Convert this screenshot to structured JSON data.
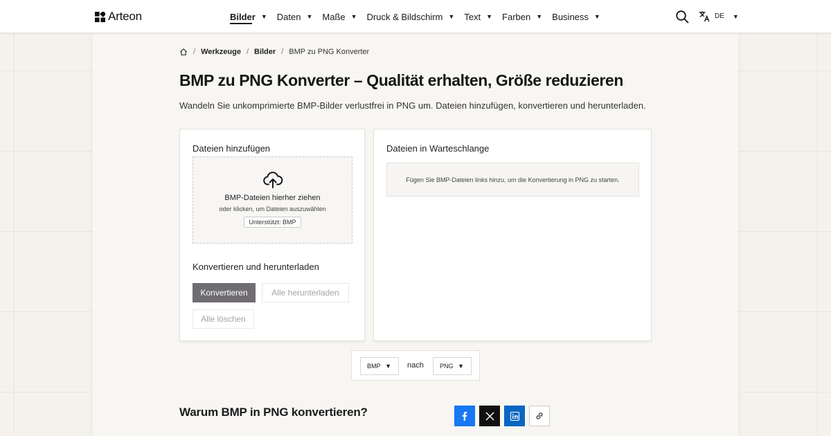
{
  "header": {
    "brand": "Arteon",
    "nav": [
      {
        "label": "Bilder",
        "active": true
      },
      {
        "label": "Daten",
        "active": false
      },
      {
        "label": "Maße",
        "active": false
      },
      {
        "label": "Druck & Bildschirm",
        "active": false
      },
      {
        "label": "Text",
        "active": false
      },
      {
        "label": "Farben",
        "active": false
      },
      {
        "label": "Business",
        "active": false
      }
    ],
    "search_icon": "search-icon",
    "language": "DE",
    "language_icon": "translate-icon",
    "caret": "▼"
  },
  "breadcrumb": {
    "home_icon": "home-icon",
    "items": [
      "Werkzeuge",
      "Bilder",
      "BMP zu PNG Konverter"
    ],
    "separator": "/"
  },
  "page": {
    "title": "BMP zu PNG Konverter – Qualität erhalten, Größe reduzieren",
    "description": "Wandeln Sie unkomprimierte BMP-Bilder verlustfrei in PNG um. Dateien hinzufügen, konvertieren und herunterladen."
  },
  "upload": {
    "heading": "Dateien hinzufügen",
    "icon": "cloud-upload-icon",
    "drop_title": "BMP-Dateien hierher ziehen",
    "drop_sub": "oder klicken, um Dateien auszuwählen",
    "supported": "Unterstützt: BMP"
  },
  "actions": {
    "heading": "Konvertieren und herunterladen",
    "convert": "Konvertieren",
    "download_all": "Alle herunterladen",
    "clear_all": "Alle löschen"
  },
  "queue": {
    "heading": "Dateien in Warteschlange",
    "empty_message": "Fügen Sie BMP-Dateien links hinzu, um die Konvertierung in PNG zu starten."
  },
  "format": {
    "from": "BMP",
    "to_word": "nach",
    "to": "PNG"
  },
  "why": {
    "title": "Warum BMP in PNG konvertieren?"
  },
  "share": {
    "icons": [
      "facebook-icon",
      "x-icon",
      "linkedin-icon",
      "link-icon"
    ]
  },
  "colors": {
    "primary_button": "#6f6c72",
    "facebook": "#1877f2",
    "x": "#111111",
    "linkedin": "#0a66c2",
    "background": "#f5f2ee"
  }
}
